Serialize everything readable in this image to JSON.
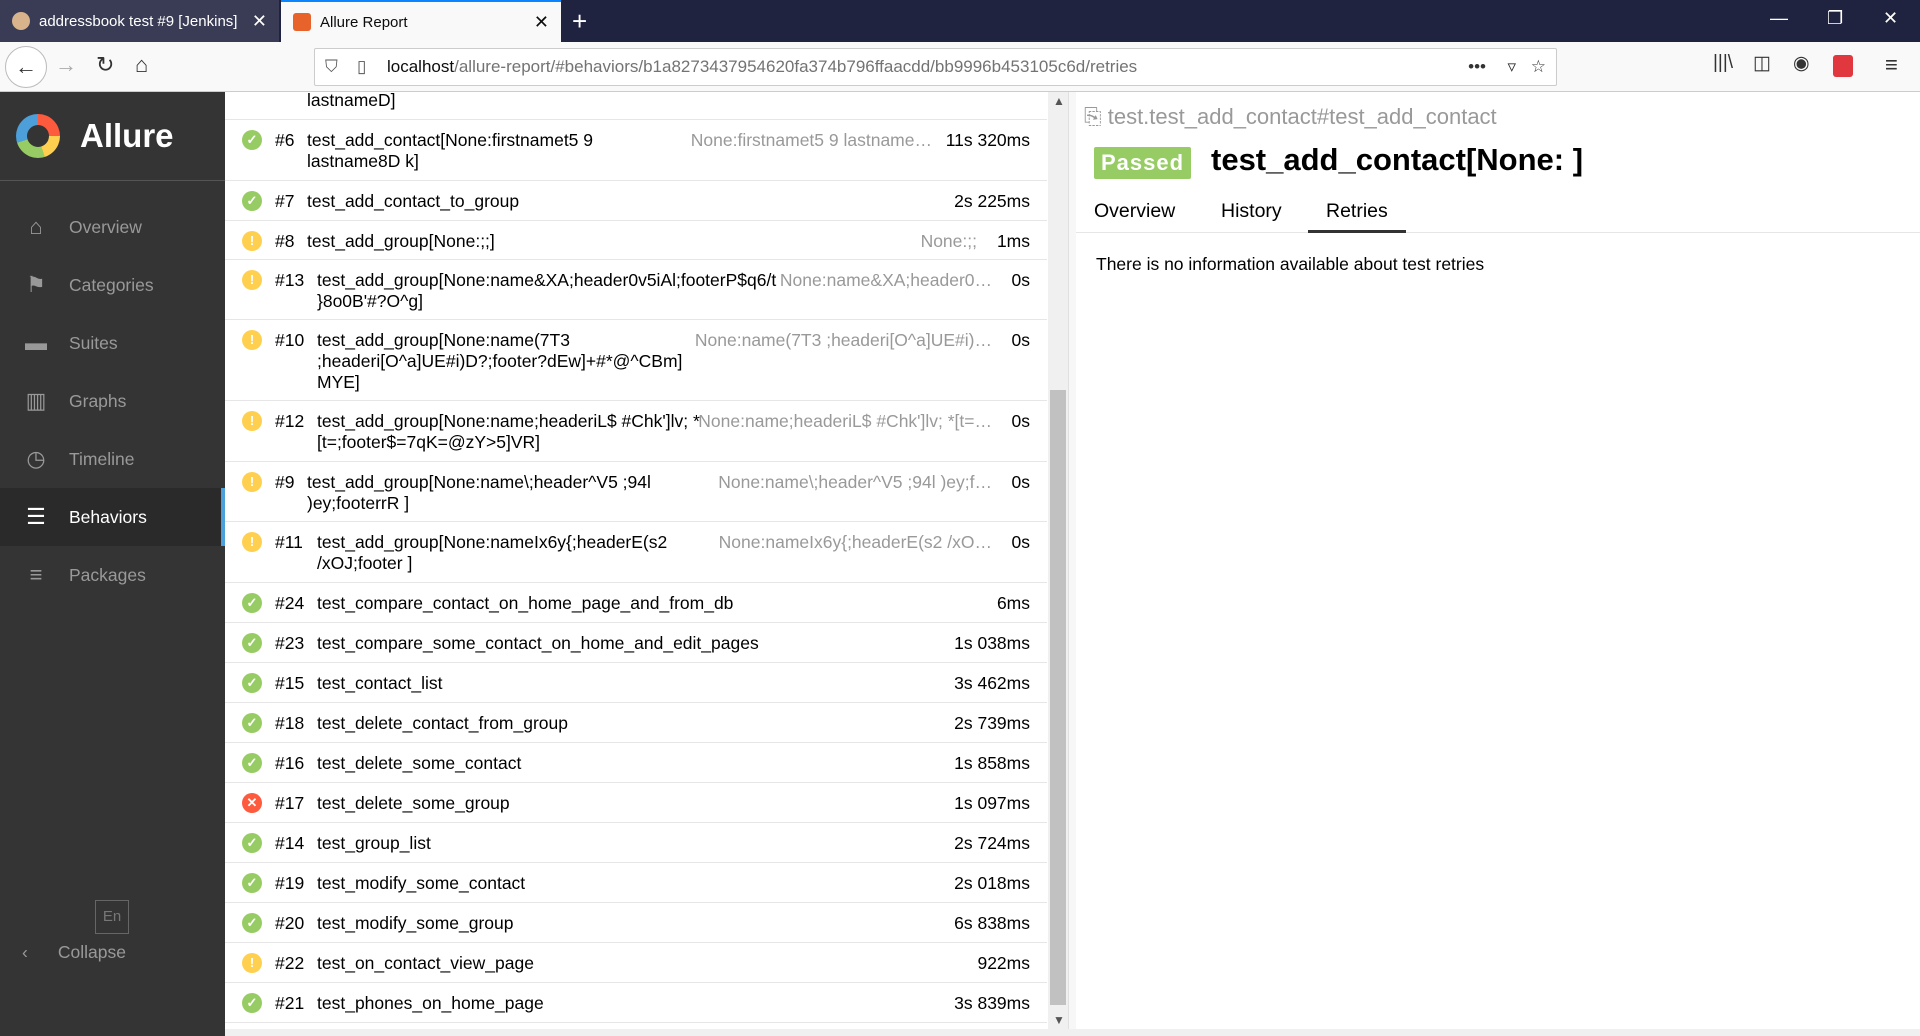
{
  "browser": {
    "tabs": [
      {
        "title": "addressbook test #9 [Jenkins]"
      },
      {
        "title": "Allure Report"
      }
    ],
    "url_host": "localhost",
    "url_path": "/allure-report/#behaviors/b1a8273437954620fa374b796ffaacdd/bb9996b453105c6d/retries"
  },
  "sidebar": {
    "logo": "Allure",
    "items": [
      {
        "label": "Overview",
        "icon": "home-icon",
        "glyph": "⌂"
      },
      {
        "label": "Categories",
        "icon": "flag-icon",
        "glyph": "⚑"
      },
      {
        "label": "Suites",
        "icon": "briefcase-icon",
        "glyph": "▬"
      },
      {
        "label": "Graphs",
        "icon": "bar-chart-icon",
        "glyph": "▥"
      },
      {
        "label": "Timeline",
        "icon": "clock-icon",
        "glyph": "◷"
      },
      {
        "label": "Behaviors",
        "icon": "list-icon",
        "glyph": "☰"
      },
      {
        "label": "Packages",
        "icon": "align-left-icon",
        "glyph": "≡"
      }
    ],
    "lang": "En",
    "collapse": "Collapse"
  },
  "list": {
    "partial": "lastnameD]",
    "rows": [
      {
        "status": "passed",
        "num": "#6",
        "name": "test_add_contact[None:firstnamet5 9 lastname8D k]",
        "param": "None:firstnamet5 9 lastname…",
        "duration": "11s 320ms"
      },
      {
        "status": "passed",
        "num": "#7",
        "name": "test_add_contact_to_group",
        "param": "",
        "duration": "2s 225ms"
      },
      {
        "status": "broken",
        "num": "#8",
        "name": "test_add_group[None:;;]",
        "param": "None:;;",
        "duration": "1ms"
      },
      {
        "status": "broken",
        "num": "#13",
        "name": "test_add_group[None:name&XA;header0v5iAl;footerP$q6/t }8o0B'#?O^g]",
        "param": "None:name&XA;header0…",
        "duration": "0s"
      },
      {
        "status": "broken",
        "num": "#10",
        "name": "test_add_group[None:name(7T3 ;headeri[O^a]UE#i)D?;footer?dEw]+#*@^CBm] MYE]",
        "param": "None:name(7T3 ;headeri[O^a]UE#i)…",
        "duration": "0s"
      },
      {
        "status": "broken",
        "num": "#12",
        "name": "test_add_group[None:name;headeriL$ #Chk']lv; *[t=;footer$=7qK=@zY>5]VR]",
        "param": "None:name;headeriL$ #Chk']lv; *[t=…",
        "duration": "0s"
      },
      {
        "status": "broken",
        "num": "#9",
        "name": "test_add_group[None:name\\;header^V5 ;94l )ey;footerrR ]",
        "param": "None:name\\;header^V5 ;94l )ey;f…",
        "duration": "0s"
      },
      {
        "status": "broken",
        "num": "#11",
        "name": "test_add_group[None:nameIx6y{;headerE(s2 /xOJ;footer ]",
        "param": "None:nameIx6y{;headerE(s2 /xO…",
        "duration": "0s"
      },
      {
        "status": "passed",
        "num": "#24",
        "name": "test_compare_contact_on_home_page_and_from_db",
        "param": "",
        "duration": "6ms"
      },
      {
        "status": "passed",
        "num": "#23",
        "name": "test_compare_some_contact_on_home_and_edit_pages",
        "param": "",
        "duration": "1s 038ms"
      },
      {
        "status": "passed",
        "num": "#15",
        "name": "test_contact_list",
        "param": "",
        "duration": "3s 462ms"
      },
      {
        "status": "passed",
        "num": "#18",
        "name": "test_delete_contact_from_group",
        "param": "",
        "duration": "2s 739ms"
      },
      {
        "status": "passed",
        "num": "#16",
        "name": "test_delete_some_contact",
        "param": "",
        "duration": "1s 858ms"
      },
      {
        "status": "failed",
        "num": "#17",
        "name": "test_delete_some_group",
        "param": "",
        "duration": "1s 097ms"
      },
      {
        "status": "passed",
        "num": "#14",
        "name": "test_group_list",
        "param": "",
        "duration": "2s 724ms"
      },
      {
        "status": "passed",
        "num": "#19",
        "name": "test_modify_some_contact",
        "param": "",
        "duration": "2s 018ms"
      },
      {
        "status": "passed",
        "num": "#20",
        "name": "test_modify_some_group",
        "param": "",
        "duration": "6s 838ms"
      },
      {
        "status": "broken",
        "num": "#22",
        "name": "test_on_contact_view_page",
        "param": "",
        "duration": "922ms"
      },
      {
        "status": "passed",
        "num": "#21",
        "name": "test_phones_on_home_page",
        "param": "",
        "duration": "3s 839ms"
      }
    ]
  },
  "detail": {
    "full_name": "test.test_add_contact#test_add_contact",
    "status": "Passed",
    "title": "test_add_contact[None: ]",
    "tabs": [
      "Overview",
      "History",
      "Retries"
    ],
    "active_tab": "Retries",
    "message": "There is no information available about test retries"
  },
  "colors": {
    "passed": "#97cc64",
    "broken": "#ffd050",
    "failed": "#fd5a3e",
    "accent": "#4c9fd9"
  }
}
